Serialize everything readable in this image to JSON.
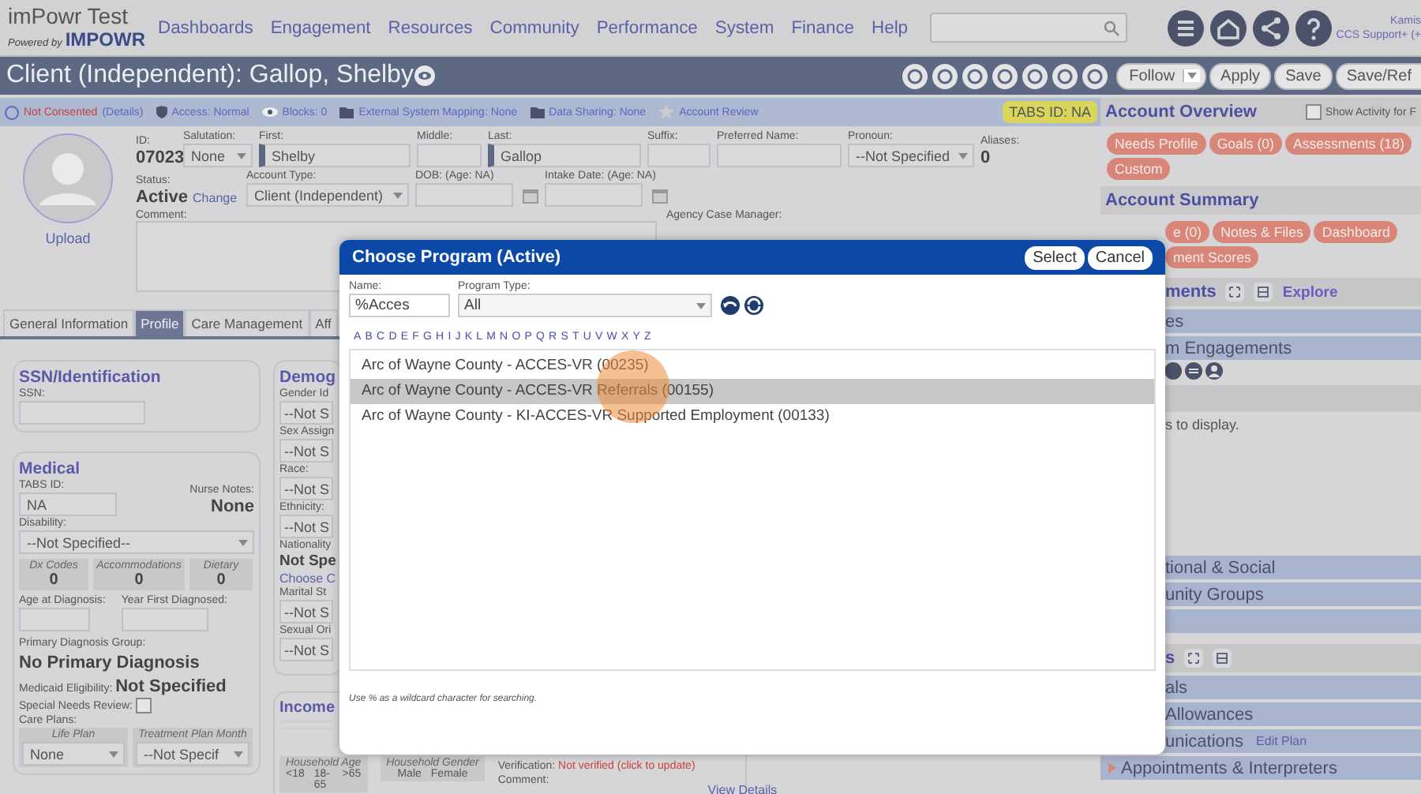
{
  "header": {
    "app_name": "imPowr Test",
    "powered_by": "Powered by",
    "brand": "IMPOWR",
    "nav": [
      "Dashboards",
      "Engagement",
      "Resources",
      "Community",
      "Performance",
      "System",
      "Finance",
      "Help"
    ],
    "user": {
      "name": "Kamis",
      "role": "CCS Support+ (+"
    }
  },
  "title_bar": {
    "title": "Client (Independent): Gallop, Shelby",
    "follow": "Follow",
    "buttons": [
      "Apply",
      "Save",
      "Save/Ref"
    ]
  },
  "info_strip": {
    "items": [
      {
        "kind": "consent",
        "text": "Not Consented",
        "link": "(Details)"
      },
      {
        "kind": "access",
        "text": "Access: Normal"
      },
      {
        "kind": "blocks",
        "text": "Blocks: 0"
      },
      {
        "kind": "mapping",
        "text": "External System Mapping: None"
      },
      {
        "kind": "sharing",
        "text": "Data Sharing: None"
      },
      {
        "kind": "review",
        "text": "Account Review"
      }
    ],
    "tabs_id": "TABS ID: NA"
  },
  "client": {
    "upload": "Upload",
    "row1": [
      {
        "kind": "static",
        "label": "ID:",
        "value": "07023"
      },
      {
        "kind": "select",
        "label": "Salutation:",
        "value": "None"
      },
      {
        "kind": "text",
        "label": "First:",
        "value": "Shelby",
        "required": true
      },
      {
        "kind": "text",
        "label": "Middle:",
        "required": false
      },
      {
        "kind": "text",
        "label": "Last:",
        "value": "Gallop",
        "required": true
      },
      {
        "kind": "text",
        "label": "Suffix:",
        "required": false
      },
      {
        "kind": "text",
        "label": "Preferred Name:",
        "required": false
      },
      {
        "kind": "select",
        "label": "Pronoun:",
        "value": "--Not Specified"
      },
      {
        "kind": "static",
        "label": "Aliases:",
        "value": "0"
      }
    ],
    "row2": [
      {
        "kind": "status",
        "label": "Status:",
        "value": "Active",
        "link": "Change"
      },
      {
        "kind": "select",
        "label": "Account Type:",
        "value": "Client (Independent)"
      },
      {
        "kind": "date",
        "label": "DOB: (Age: NA)"
      },
      {
        "kind": "date",
        "label": "Intake Date: (Age: NA)"
      }
    ],
    "comment": "Comment:",
    "case_manager": "Agency Case Manager:"
  },
  "tabs": [
    {
      "label": "General Information",
      "selected": false
    },
    {
      "label": "Profile",
      "selected": true
    },
    {
      "label": "Care Management",
      "selected": false
    },
    {
      "label": "Aff",
      "selected": false
    }
  ],
  "ssn": {
    "title": "SSN/Identification",
    "label": "SSN:"
  },
  "medical": {
    "title": "Medical",
    "tabs_id": {
      "label": "TABS ID:",
      "value": "NA"
    },
    "nurse_notes": {
      "label": "Nurse Notes:",
      "value": "None"
    },
    "disability": {
      "label": "Disability:",
      "value": "--Not Specified--"
    },
    "counters": [
      {
        "label": "Dx Codes",
        "value": "0"
      },
      {
        "label": "Accommodations",
        "value": "0"
      },
      {
        "label": "Dietary",
        "value": "0"
      }
    ],
    "age_at_diagnosis": "Age at Diagnosis:",
    "year_first": "Year First Diagnosed:",
    "primary_group": {
      "label": "Primary Diagnosis Group:",
      "value": "No Primary Diagnosis"
    },
    "medicaid": {
      "label": "Medicaid Eligibility:",
      "value": "Not Specified"
    },
    "special_needs": {
      "label": "Special Needs Review:",
      "checked": false
    },
    "care_plans": {
      "label": "Care Plans:",
      "plans": [
        {
          "label": "Life Plan",
          "value": "None"
        },
        {
          "label": "Treatment Plan Month",
          "value": "--Not Specif"
        }
      ]
    }
  },
  "demographics": {
    "title": "Demog",
    "items": [
      {
        "kind": "select",
        "label": "Gender Id",
        "value": "--Not S"
      },
      {
        "kind": "select",
        "label": "Sex Assign",
        "value": "--Not S"
      },
      {
        "kind": "select",
        "label": "Race:",
        "value": "--Not S"
      },
      {
        "kind": "select",
        "label": "Ethnicity:",
        "value": "--Not S"
      },
      {
        "kind": "static",
        "label": "Nationality",
        "value": "Not Spe",
        "link": "Choose C"
      },
      {
        "kind": "select",
        "label": "Marital St",
        "value": "--Not S"
      },
      {
        "kind": "select",
        "label": "Sexual Ori",
        "value": "--Not S"
      }
    ]
  },
  "income": {
    "title": "Income",
    "household_age": {
      "label": "Household Age",
      "options": [
        "<18",
        "18-65",
        ">65"
      ]
    },
    "household_gender": {
      "label": "Household Gender",
      "options": [
        "Male",
        "Female"
      ]
    },
    "verification": {
      "label": "Verification:",
      "value": "Not verified (click to update)"
    },
    "comment": "Comment:",
    "view_details": "View Details"
  },
  "right_panel": {
    "overview": {
      "title": "Account Overview",
      "show_activity": {
        "label": "Show Activity for F",
        "checked": false
      },
      "buttons": [
        "Needs Profile",
        "Goals (0)",
        "Assessments (18)",
        "Custom"
      ]
    },
    "summary": {
      "title": "Account Summary",
      "buttons": [
        "e (0)",
        "Notes & Files",
        "Dashboard",
        "ment Scores"
      ]
    },
    "sections": [
      {
        "title": "ments",
        "explore": "Explore",
        "rows": [
          {
            "kind": "row",
            "text": "es",
            "arrow": false
          },
          {
            "kind": "row",
            "text": "m Engagements",
            "arrow": false
          },
          {
            "kind": "icons"
          },
          {
            "kind": "bar"
          },
          {
            "kind": "note",
            "text": "s to display."
          },
          {
            "kind": "row",
            "text": "tional & Social",
            "arrow": false
          },
          {
            "kind": "row",
            "text": "unity Groups",
            "arrow": false
          },
          {
            "kind": "row"
          }
        ]
      },
      {
        "title": "s",
        "rows": [
          {
            "kind": "row",
            "text": "als",
            "arrow": false
          },
          {
            "kind": "row",
            "text": "Allowances",
            "arrow": false
          },
          {
            "kind": "row",
            "text": "unications",
            "link": "Edit Plan",
            "arrow": false
          },
          {
            "kind": "row",
            "text": "Appointments & Interpreters",
            "arrow": true
          }
        ]
      }
    ]
  },
  "modal": {
    "title": "Choose Program (Active)",
    "buttons": [
      "Select",
      "Cancel"
    ],
    "name": {
      "label": "Name:",
      "value": "%Acces"
    },
    "program_type": {
      "label": "Program Type:",
      "value": "All"
    },
    "letters": [
      "A",
      "B",
      "C",
      "D",
      "E",
      "F",
      "G",
      "H",
      "I",
      "J",
      "K",
      "L",
      "M",
      "N",
      "O",
      "P",
      "Q",
      "R",
      "S",
      "T",
      "U",
      "V",
      "W",
      "X",
      "Y",
      "Z"
    ],
    "programs": [
      {
        "label": "Arc of Wayne County - ACCES-VR (00235)",
        "selected": false
      },
      {
        "label": "Arc of Wayne County - ACCES-VR Referrals (00155)",
        "selected": true
      },
      {
        "label": "Arc of Wayne County - KI-ACCES-VR Supported Employment (00133)",
        "selected": false
      }
    ],
    "hint": "Use % as a wildcard character for searching."
  }
}
